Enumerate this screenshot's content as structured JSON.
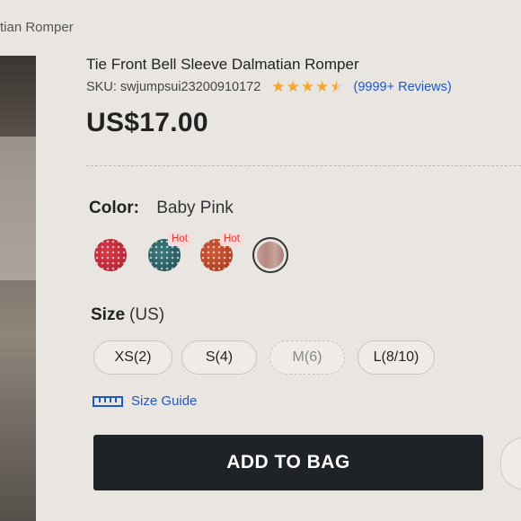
{
  "breadcrumb": {
    "text": "tian Romper"
  },
  "product": {
    "title": "Tie Front Bell Sleeve Dalmatian Romper",
    "sku": "SKU: swjumpsui23200910172",
    "rating": 4.5,
    "reviews": "(9999+ Reviews)",
    "price": "US$17.00"
  },
  "color": {
    "label": "Color:",
    "selected": "Baby Pink",
    "swatches": [
      {
        "name": "red-dalmatian",
        "color": "#c22a38",
        "hot": "",
        "selected": false
      },
      {
        "name": "teal-dalmatian",
        "color": "#2f6a6f",
        "hot": "Hot",
        "selected": false
      },
      {
        "name": "rust-dalmatian",
        "color": "#c44a2a",
        "hot": "Hot",
        "selected": false
      },
      {
        "name": "baby-pink",
        "color": "#be958d",
        "hot": "",
        "selected": true
      }
    ]
  },
  "size": {
    "label": "Size",
    "unit": "(US)",
    "options": [
      "XS(2)",
      "S(4)",
      "M(6)",
      "L(8/10)"
    ],
    "unavailable": [
      "M(6)"
    ]
  },
  "size_guide": "Size Guide",
  "add_to_bag": "ADD TO BAG",
  "colors": {
    "accent": "#1f59c7",
    "star": "#f4a72a",
    "hot": "#e0372f",
    "button": "#1f2328"
  }
}
